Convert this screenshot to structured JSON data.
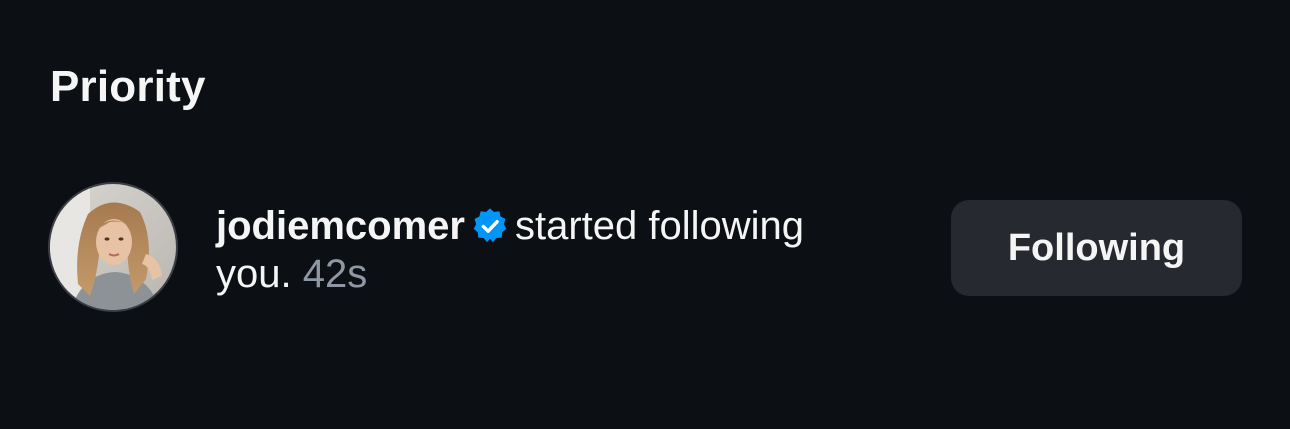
{
  "section": {
    "title": "Priority"
  },
  "notification": {
    "username": "jodiemcomer",
    "verified_icon": "verified-badge-icon",
    "action_text": "started following you.",
    "time": "42s",
    "button_label": "Following"
  },
  "colors": {
    "background": "#0c1014",
    "text": "#f5f5f5",
    "muted": "#8e97a3",
    "verified": "#0095f6",
    "button_bg": "#262a30"
  }
}
